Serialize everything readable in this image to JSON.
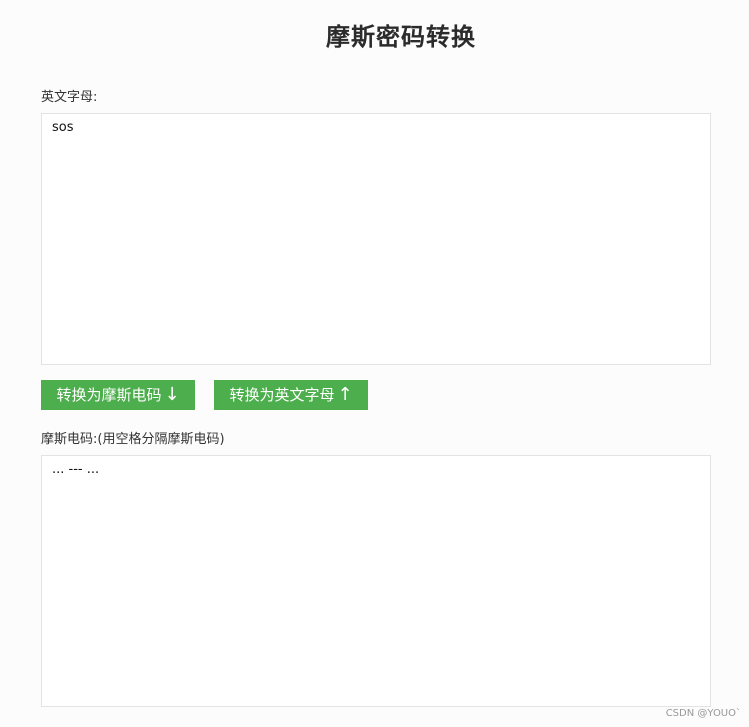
{
  "page": {
    "title": "摩斯密码转换"
  },
  "english": {
    "label": "英文字母:",
    "value": "sos"
  },
  "buttons": {
    "to_morse": "转换为摩斯电码",
    "to_morse_arrow": "↓",
    "to_english": "转换为英文字母",
    "to_english_arrow": "↑"
  },
  "morse": {
    "label": "摩斯电码:(用空格分隔摩斯电码)",
    "value": "... --- ..."
  },
  "watermark": "CSDN @YOUO`",
  "colors": {
    "button_bg": "#4cae4c",
    "button_text": "#ffffff",
    "page_bg": "#fcfcfc"
  }
}
